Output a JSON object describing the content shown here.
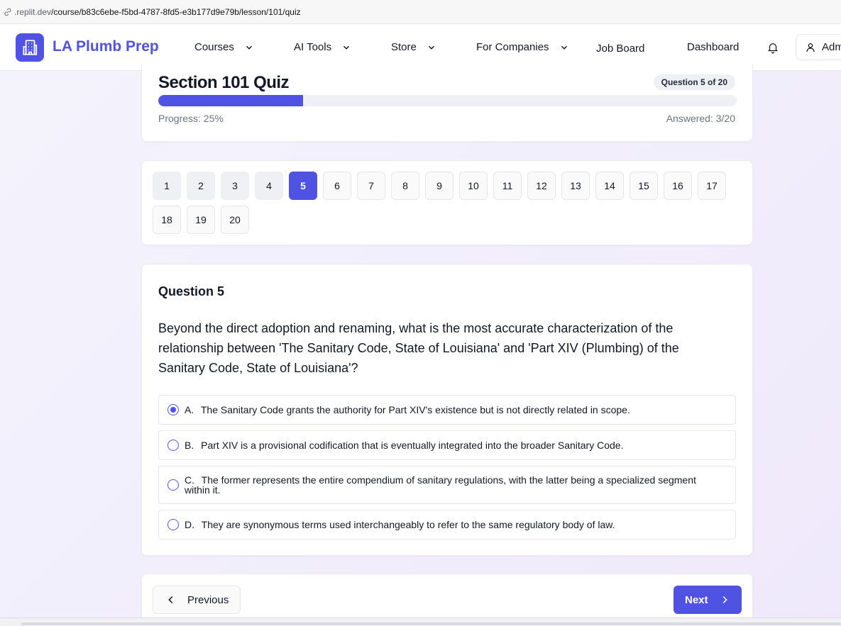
{
  "browser": {
    "url_host": ".replit.dev",
    "url_path": "/course/b83c6ebe-f5bd-4787-8fd5-e3b177d9e79b/lesson/101/quiz"
  },
  "nav": {
    "brand": "LA Plumb Prep",
    "items": [
      {
        "label": "Courses",
        "has_dropdown": true
      },
      {
        "label": "AI Tools",
        "has_dropdown": true
      },
      {
        "label": "Store",
        "has_dropdown": true
      },
      {
        "label": "For Companies",
        "has_dropdown": true
      },
      {
        "label": "Job Board",
        "has_dropdown": false
      },
      {
        "label": "Dashboard",
        "has_dropdown": false
      }
    ],
    "user_label": "Adm",
    "accent": "#4f52e2"
  },
  "quiz": {
    "title": "Section 101 Quiz",
    "question_badge": "Question 5 of 20",
    "progress_fraction": 0.25,
    "progress_label": "Progress: 25%",
    "answered_label": "Answered: 3/20",
    "current_question": 5,
    "question_numbers": [
      "1",
      "2",
      "3",
      "4",
      "5",
      "6",
      "7",
      "8",
      "9",
      "10",
      "11",
      "12",
      "13",
      "14",
      "15",
      "16",
      "17",
      "18",
      "19",
      "20"
    ]
  },
  "question": {
    "label": "Question 5",
    "text": "Beyond the direct adoption and renaming, what is the most accurate characterization of the relationship between 'The Sanitary Code, State of Louisiana' and 'Part XIV (Plumbing) of the Sanitary Code, State of Louisiana'?",
    "options": [
      {
        "letter": "A.",
        "text": "The Sanitary Code grants the authority for Part XIV's existence but is not directly related in scope.",
        "selected": true
      },
      {
        "letter": "B.",
        "text": "Part XIV is a provisional codification that is eventually integrated into the broader Sanitary Code.",
        "selected": false
      },
      {
        "letter": "C.",
        "text": "The former represents the entire compendium of sanitary regulations, with the latter being a specialized segment within it.",
        "selected": false
      },
      {
        "letter": "D.",
        "text": "They are synonymous terms used interchangeably to refer to the same regulatory body of law.",
        "selected": false
      }
    ]
  },
  "footer_nav": {
    "previous_label": "Previous",
    "next_label": "Next"
  }
}
